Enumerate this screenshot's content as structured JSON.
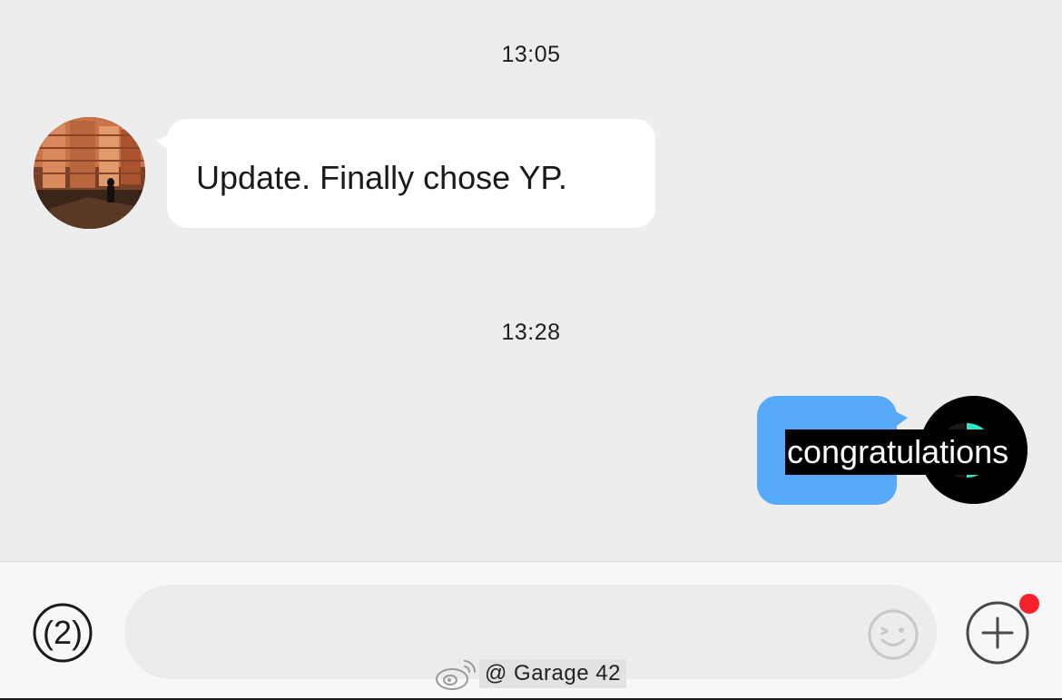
{
  "chat": {
    "messages": [
      {
        "timestamp": "13:05",
        "direction": "incoming",
        "text": "Update. Finally chose YP."
      },
      {
        "timestamp": "13:28",
        "direction": "outgoing",
        "text": "congratulations"
      }
    ]
  },
  "input_bar": {
    "voice_label": "(2)",
    "message_placeholder": "",
    "emoji_icon": "emoji-icon",
    "plus_icon": "plus-icon",
    "has_notification_dot": true
  },
  "watermark": {
    "text": "@ Garage 42"
  },
  "colors": {
    "background": "#ededed",
    "incoming_bubble": "#ffffff",
    "outgoing_bubble": "#55a9f8",
    "notification": "#f5222d",
    "avatar_accent": "#2ee6c8"
  }
}
